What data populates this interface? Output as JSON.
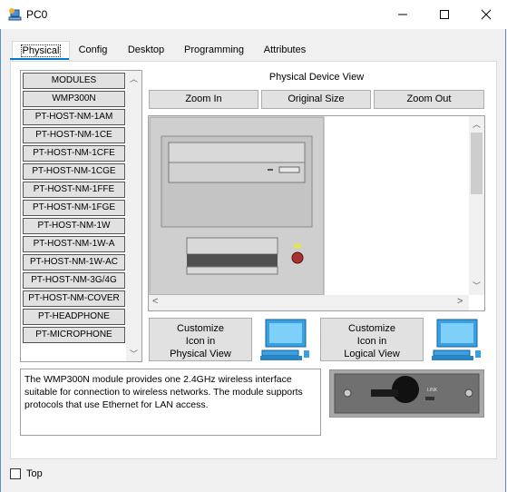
{
  "window": {
    "title": "PC0"
  },
  "tabs": [
    {
      "label": "Physical"
    },
    {
      "label": "Config"
    },
    {
      "label": "Desktop"
    },
    {
      "label": "Programming"
    },
    {
      "label": "Attributes"
    }
  ],
  "modules": [
    "MODULES",
    "WMP300N",
    "PT-HOST-NM-1AM",
    "PT-HOST-NM-1CE",
    "PT-HOST-NM-1CFE",
    "PT-HOST-NM-1CGE",
    "PT-HOST-NM-1FFE",
    "PT-HOST-NM-1FGE",
    "PT-HOST-NM-1W",
    "PT-HOST-NM-1W-A",
    "PT-HOST-NM-1W-AC",
    "PT-HOST-NM-3G/4G",
    "PT-HOST-NM-COVER",
    "PT-HEADPHONE",
    "PT-MICROPHONE"
  ],
  "view": {
    "title": "Physical Device View",
    "zoom_in": "Zoom In",
    "original_size": "Original Size",
    "zoom_out": "Zoom Out"
  },
  "customize": {
    "physical": "Customize\nIcon in\nPhysical View",
    "logical": "Customize\nIcon in\nLogical View"
  },
  "description": "The WMP300N module provides one 2.4GHz wireless interface suitable for connection to wireless networks. The module supports protocols that use Ethernet for LAN access.",
  "module_image_label": "LINK",
  "footer": {
    "top_label": "Top",
    "top_checked": false
  },
  "colors": {
    "accent": "#0078d7",
    "button_bg": "#e1e1e1",
    "window_bg": "#f0f0f0"
  }
}
